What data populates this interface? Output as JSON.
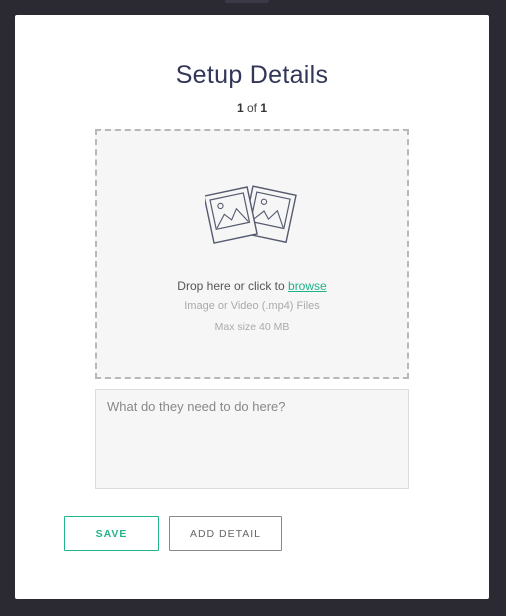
{
  "modal": {
    "title": "Setup Details",
    "pager": {
      "current": "1",
      "separator": "of",
      "total": "1"
    }
  },
  "dropzone": {
    "prompt": "Drop here or click to",
    "link_label": "browse",
    "file_types": "Image or Video (.mp4) Files",
    "max_size": "Max size 40 MB",
    "icon": "photos-icon"
  },
  "notes": {
    "placeholder": "What do they need to do here?",
    "value": ""
  },
  "actions": {
    "save_label": "SAVE",
    "add_detail_label": "ADD DETAIL"
  },
  "colors": {
    "accent": "#24b48c",
    "link": "#1fb38a",
    "title": "#323657",
    "backdrop": "#2b2a33"
  }
}
